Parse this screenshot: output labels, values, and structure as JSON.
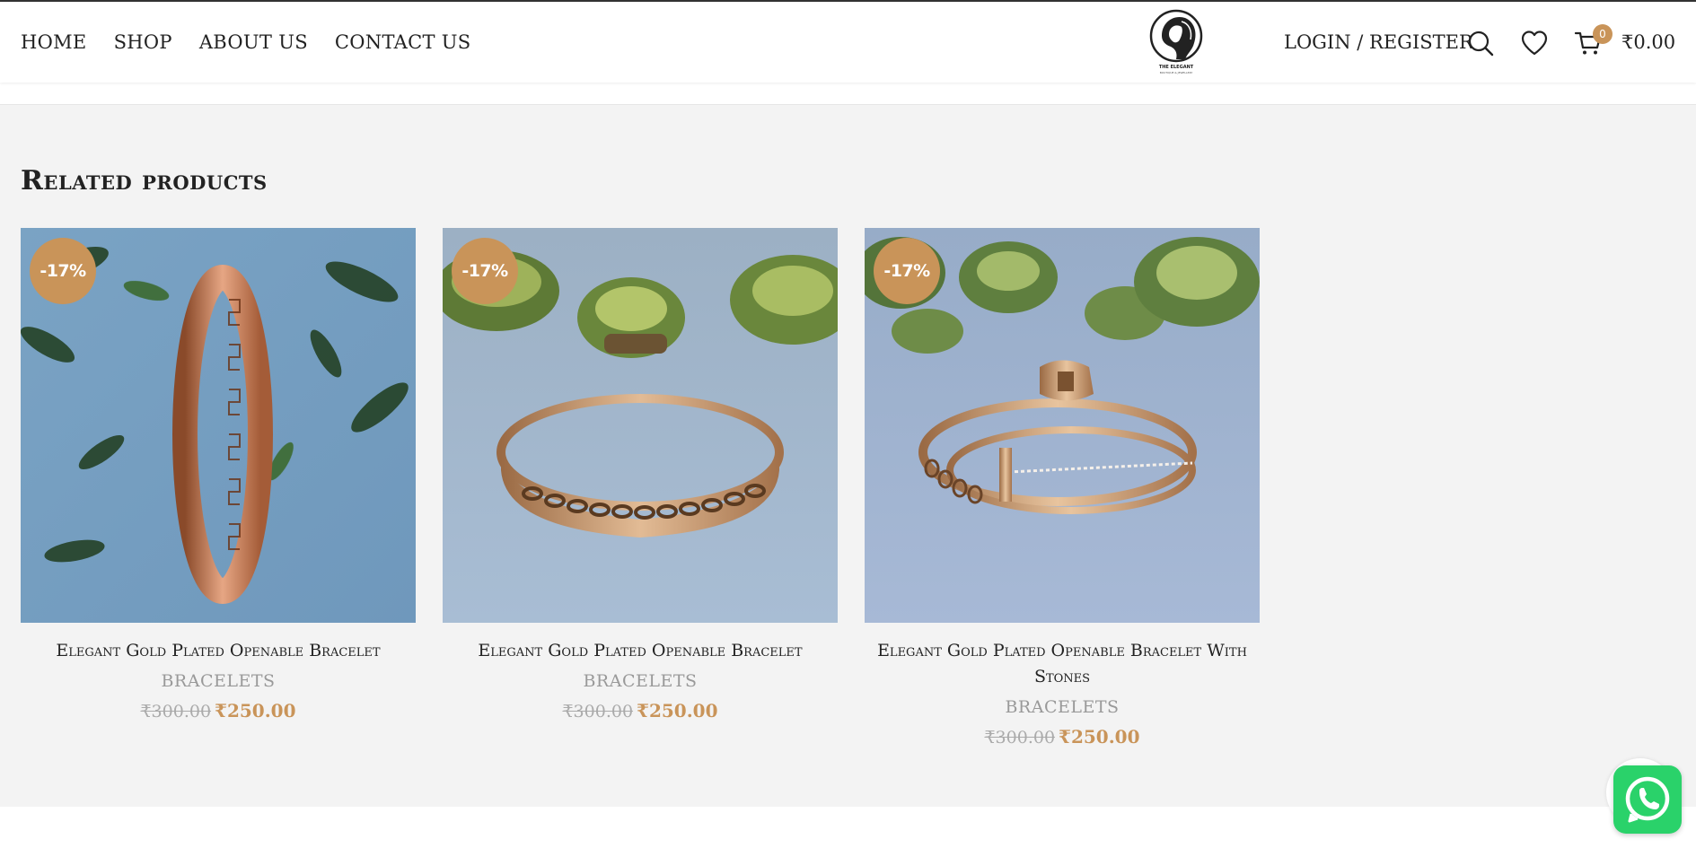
{
  "header": {
    "nav": [
      "HOME",
      "SHOP",
      "ABOUT US",
      "CONTACT US"
    ],
    "logo_text": "THE ELEGANT",
    "logo_subtext": "BOUTIQUE & JEWELLERY",
    "login_label": "LOGIN / REGISTER",
    "cart_count": "0",
    "cart_total": "₹0.00"
  },
  "section": {
    "title": "Related products"
  },
  "products": [
    {
      "badge": "-17%",
      "name": "Elegant Gold Plated Openable Bracelet",
      "category": "BRACELETS",
      "old_price": "₹300.00",
      "new_price": "₹250.00"
    },
    {
      "badge": "-17%",
      "name": "Elegant Gold Plated Openable Bracelet",
      "category": "BRACELETS",
      "old_price": "₹300.00",
      "new_price": "₹250.00"
    },
    {
      "badge": "-17%",
      "name": "Elegant Gold Plated Openable Bracelet With Stones",
      "category": "BRACELETS",
      "old_price": "₹300.00",
      "new_price": "₹250.00"
    }
  ],
  "colors": {
    "accent": "#c99459",
    "section_bg": "#f3f3f3",
    "whatsapp": "#2ad26a"
  },
  "icons": [
    "search-icon",
    "heart-icon",
    "cart-icon",
    "whatsapp-icon"
  ]
}
